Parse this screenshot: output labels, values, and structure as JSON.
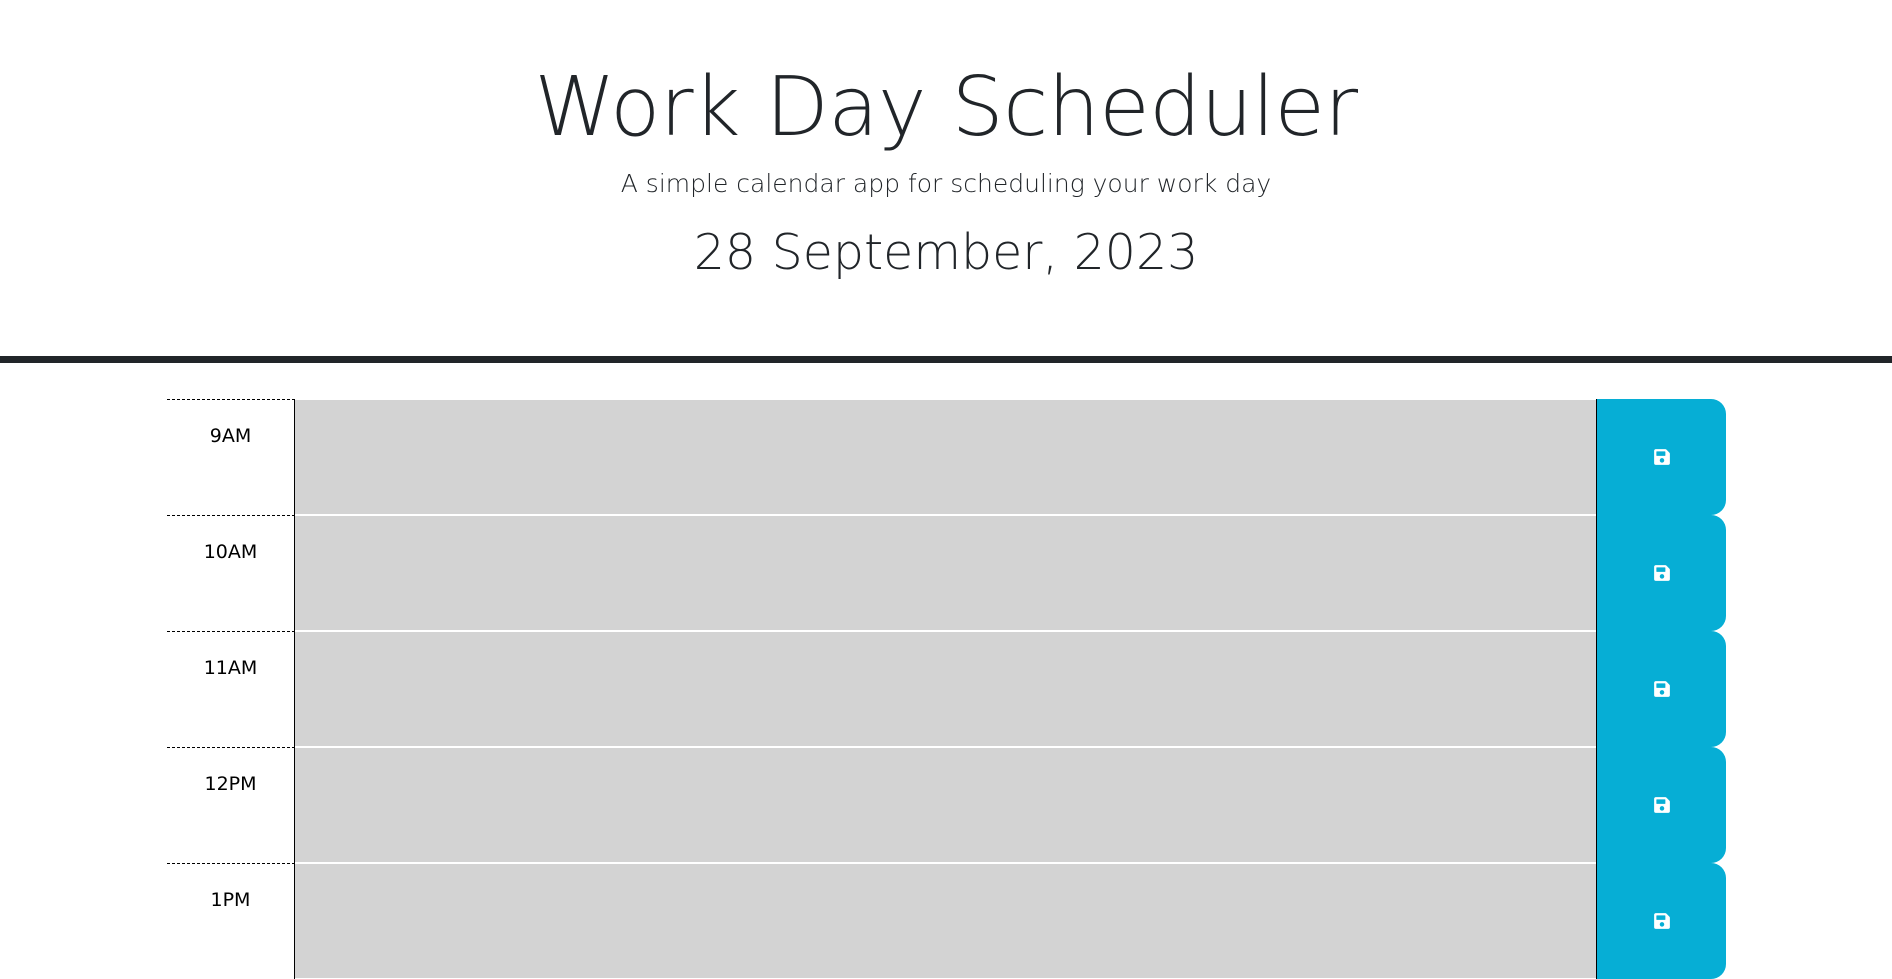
{
  "header": {
    "title": "Work Day Scheduler",
    "subtitle": "A simple calendar app for scheduling your work day",
    "current_day": "28 September, 2023"
  },
  "time_blocks": [
    {
      "hour": "9AM",
      "description": ""
    },
    {
      "hour": "10AM",
      "description": ""
    },
    {
      "hour": "11AM",
      "description": ""
    },
    {
      "hour": "12PM",
      "description": ""
    },
    {
      "hour": "1PM",
      "description": ""
    }
  ],
  "colors": {
    "past_block": "#d3d3d3",
    "save_button": "#06aed5",
    "text": "#212529",
    "header_border": "#212529"
  },
  "icons": {
    "save": "save-icon"
  }
}
